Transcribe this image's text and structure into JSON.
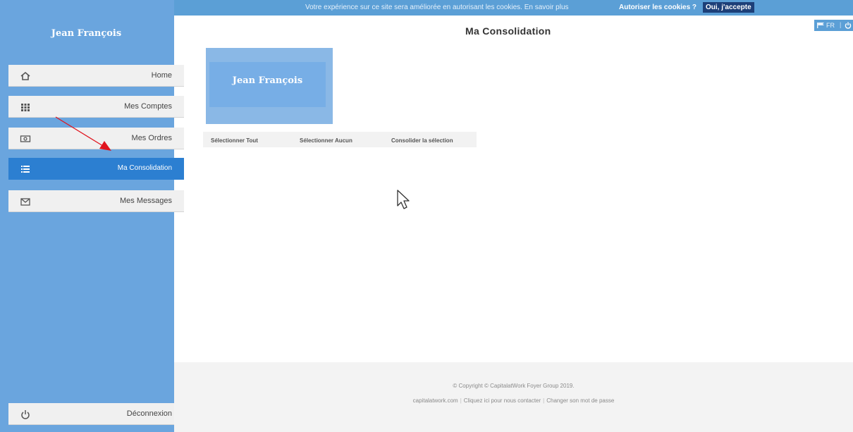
{
  "cookie_bar": {
    "message": "Votre expérience sur ce site sera améliorée en autorisant les cookies. En savoir plus",
    "allow_label": "Autoriser les cookies ?",
    "accept_label": "Oui, j'accepte"
  },
  "sidebar": {
    "user_name": "Jean François",
    "items": [
      {
        "label": "Home",
        "icon": "home-icon"
      },
      {
        "label": "Mes Comptes",
        "icon": "grid-icon"
      },
      {
        "label": "Mes Ordres",
        "icon": "money-icon"
      },
      {
        "label": "Ma Consolidation",
        "icon": "list-icon"
      },
      {
        "label": "Mes Messages",
        "icon": "envelope-icon"
      }
    ],
    "logout_label": "Déconnexion",
    "active_color": "#2c7fd1"
  },
  "header": {
    "title": "Ma Consolidation",
    "lang": "FR"
  },
  "main": {
    "account_name": "Jean François",
    "actions": {
      "select_all": "Sélectionner Tout",
      "select_none": "Sélectionner Aucun",
      "consolidate": "Consolider la sélection"
    }
  },
  "footer": {
    "copyright": "© Copyright © CapitalatWork Foyer Group 2019.",
    "links": [
      "capitalatwork.com",
      "Cliquez ici pour nous contacter",
      "Changer son mot de passe"
    ]
  },
  "colors": {
    "sidebar": "#6aa5de",
    "accent": "#2c7fd1",
    "annotation_arrow": "#e0141e"
  }
}
